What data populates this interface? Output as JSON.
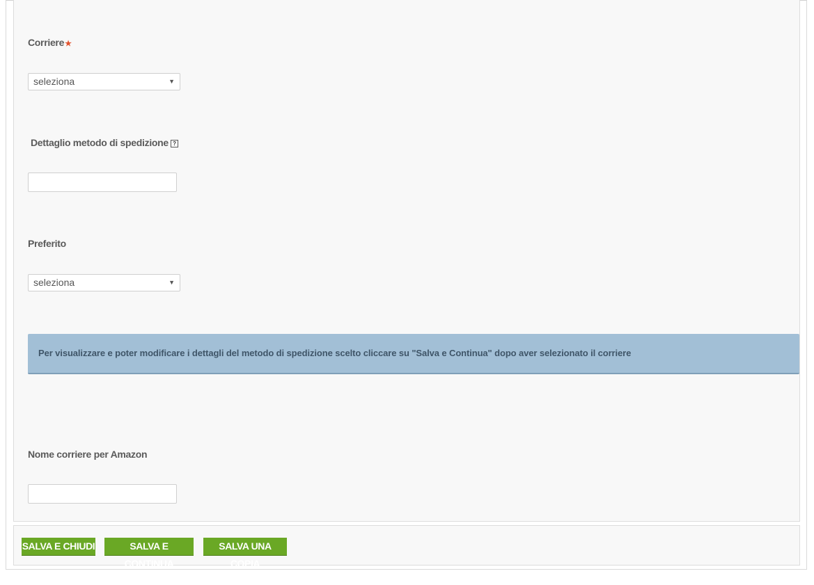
{
  "form": {
    "corriere_label": "Corriere",
    "required_star": "★",
    "corriere_select_value": "seleziona",
    "dettaglio_label": "Dettaglio metodo di spedizione",
    "help_icon_glyph": "?",
    "dettaglio_value": "",
    "preferito_label": "Preferito",
    "preferito_select_value": "seleziona",
    "info_text": "Per visualizzare e poter modificare i dettagli del metodo di spedizione scelto cliccare su \"Salva e Continua\" dopo aver selezionato il corriere",
    "amazon_label": "Nome corriere per Amazon",
    "amazon_value": ""
  },
  "actions": {
    "save_close": "SALVA E CHIUDI",
    "save_continue": "SALVA E CONTINUA",
    "save_copy": "SALVA UNA COPIA"
  },
  "colors": {
    "button_green": "#6aa825",
    "info_background": "#a2bfd6",
    "required_star": "#e2532f"
  },
  "icons": {
    "select_arrow": "▼"
  }
}
